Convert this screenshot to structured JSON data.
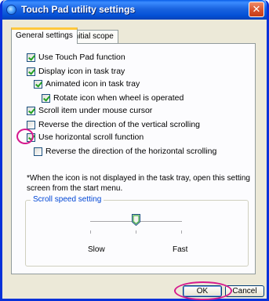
{
  "window": {
    "title": "Touch Pad utility settings",
    "close_symbol": "✕"
  },
  "tabs": [
    {
      "label": "General settings",
      "active": true
    },
    {
      "label": "Initial scope",
      "active": false
    }
  ],
  "options": [
    {
      "label": "Use Touch Pad function",
      "checked": true
    },
    {
      "label": "Display icon in task tray",
      "checked": true
    },
    {
      "label": "Animated icon in task tray",
      "checked": true
    },
    {
      "label": "Rotate icon when wheel is operated",
      "checked": true
    },
    {
      "label": "Scroll item under mouse cursor",
      "checked": true
    },
    {
      "label": "Reverse the direction of the vertical scrolling",
      "checked": false
    },
    {
      "label": "Use horizontal scroll function",
      "checked": true
    },
    {
      "label": "Reverse the direction of the horizontal scrolling",
      "checked": false
    }
  ],
  "note": "*When the icon is not displayed in the task tray, open this setting screen from the start menu.",
  "scroll_speed": {
    "legend": "Scroll speed setting",
    "min_label": "Slow",
    "max_label": "Fast",
    "level_fraction": 0.5
  },
  "buttons": {
    "ok_label": "OK",
    "cancel_label": "Cancel"
  },
  "colors": {
    "title_bar": "#0a5ee8",
    "close_button": "#d9532c",
    "highlight": "#d6198e",
    "group_legend": "#0046d5"
  }
}
